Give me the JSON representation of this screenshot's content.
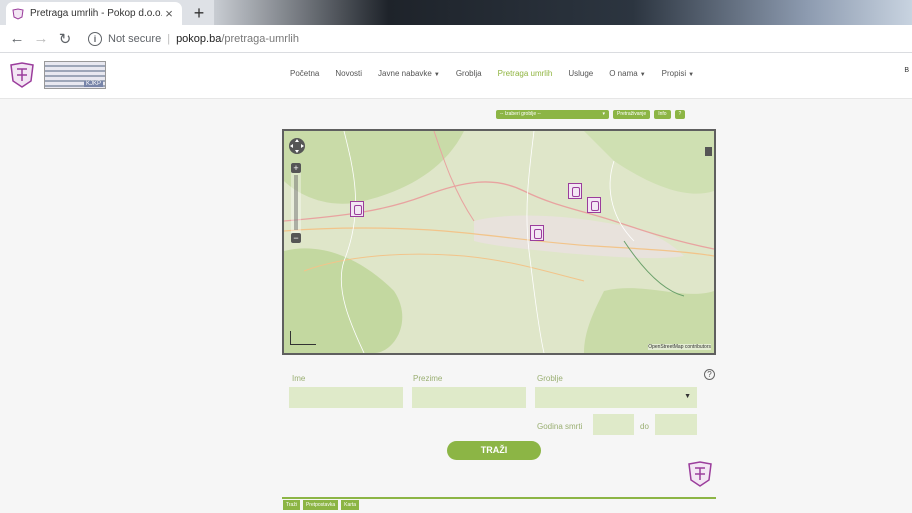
{
  "browser": {
    "tab_title": "Pretraga umrlih - Pokop d.o.o.",
    "close_glyph": "×",
    "newtab_glyph": "+",
    "not_secure": "Not secure",
    "host": "pokop.ba",
    "path": "/pretraga-umrlih",
    "back_glyph": "←",
    "forward_glyph": "→",
    "reload_glyph": "↻"
  },
  "site": {
    "logo_badge": "KJKP",
    "nav": [
      {
        "label": "Početna",
        "dropdown": false,
        "active": false
      },
      {
        "label": "Novosti",
        "dropdown": false,
        "active": false
      },
      {
        "label": "Javne nabavke",
        "dropdown": true,
        "active": false
      },
      {
        "label": "Groblja",
        "dropdown": false,
        "active": false
      },
      {
        "label": "Pretraga umrlih",
        "dropdown": false,
        "active": true
      },
      {
        "label": "Usluge",
        "dropdown": false,
        "active": false
      },
      {
        "label": "O nama",
        "dropdown": true,
        "active": false
      },
      {
        "label": "Propisi",
        "dropdown": true,
        "active": false
      }
    ],
    "right_text": "B"
  },
  "map_toolbar": {
    "cemetery_select": "-- Izaberi groblje --",
    "btn_search": "Pretraživanje",
    "btn_info": "Info",
    "btn_help": "?"
  },
  "map": {
    "attribution": "OpenStreetMap contributors",
    "zoom_in": "+",
    "zoom_out": "−",
    "markers": 4
  },
  "form": {
    "ime_label": "Ime",
    "prezime_label": "Prezime",
    "groblje_label": "Groblje",
    "godina_label": "Godina smrti",
    "do_label": "do",
    "submit_label": "TRAŽI",
    "help_glyph": "?"
  },
  "bottom_tabs": [
    "Traži",
    "Pretpostavka",
    "Karta"
  ],
  "colors": {
    "accent": "#8cb545",
    "marker": "#9b3d9c"
  }
}
